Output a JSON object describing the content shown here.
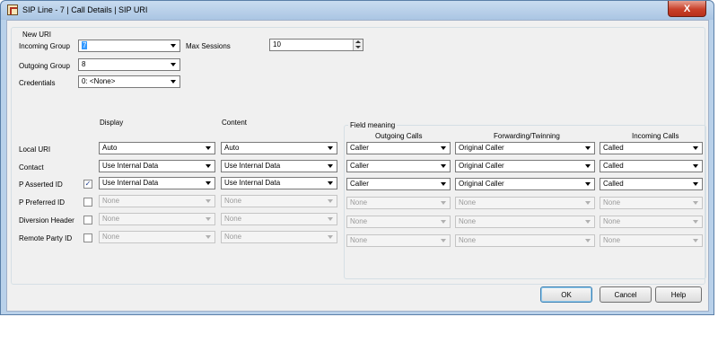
{
  "window": {
    "title": "SIP Line - 7 | Call Details | SIP URI",
    "close_label": "X"
  },
  "group": {
    "legend": "New URI"
  },
  "incoming_group": {
    "label": "Incoming Group",
    "value": "7"
  },
  "max_sessions": {
    "label": "Max Sessions",
    "value": "10"
  },
  "outgoing_group": {
    "label": "Outgoing Group",
    "value": "8"
  },
  "credentials": {
    "label": "Credentials",
    "value": "0: <None>"
  },
  "headers": {
    "display": "Display",
    "content": "Content",
    "field_meaning": "Field meaning",
    "outgoing_calls": "Outgoing Calls",
    "forwarding": "Forwarding/Twinning",
    "incoming_calls": "Incoming Calls"
  },
  "rows": [
    {
      "label": "Local URI",
      "display": "Auto",
      "content": "Auto",
      "outgoing": "Caller",
      "forwarding": "Original Caller",
      "incoming": "Called"
    },
    {
      "label": "Contact",
      "display": "Use Internal Data",
      "content": "Use Internal Data",
      "outgoing": "Caller",
      "forwarding": "Original Caller",
      "incoming": "Called"
    },
    {
      "label": "P Asserted ID",
      "checkbox": "✓",
      "display": "Use Internal Data",
      "content": "Use Internal Data",
      "outgoing": "Caller",
      "forwarding": "Original Caller",
      "incoming": "Called"
    },
    {
      "label": "P Preferred  ID",
      "checkbox": "",
      "display": "None",
      "content": "None",
      "outgoing": "None",
      "forwarding": "None",
      "incoming": "None"
    },
    {
      "label": "Diversion Header",
      "checkbox": "",
      "display": "None",
      "content": "None",
      "outgoing": "None",
      "forwarding": "None",
      "incoming": "None"
    },
    {
      "label": "Remote Party ID",
      "checkbox": "",
      "display": "None",
      "content": "None",
      "outgoing": "None",
      "forwarding": "None",
      "incoming": "None"
    }
  ],
  "buttons": {
    "ok": "OK",
    "cancel": "Cancel",
    "help": "Help"
  }
}
